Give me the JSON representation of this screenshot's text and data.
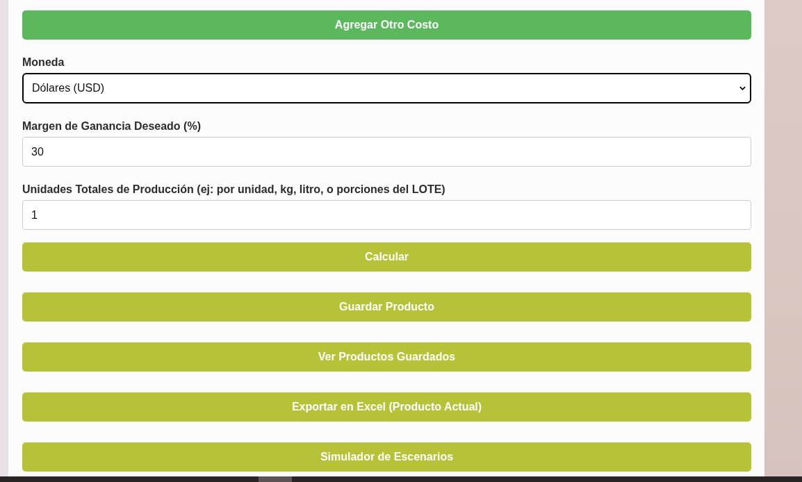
{
  "add_cost_button": "Agregar Otro Costo",
  "fields": [
    {
      "kind": "select",
      "label": "Moneda",
      "value": "Dólares (USD)",
      "focused": true
    },
    {
      "kind": "input",
      "label": "Margen de Ganancia Deseado (%)",
      "value": "30",
      "focused": false
    },
    {
      "kind": "input",
      "label": "Unidades Totales de Producción (ej: por unidad, kg, litro, o porciones del LOTE)",
      "value": "1",
      "focused": false
    }
  ],
  "actions": [
    "Calcular",
    "Guardar Producto",
    "Ver Productos Guardados",
    "Exportar en Excel (Producto Actual)",
    "Simulador de Escenarios"
  ]
}
